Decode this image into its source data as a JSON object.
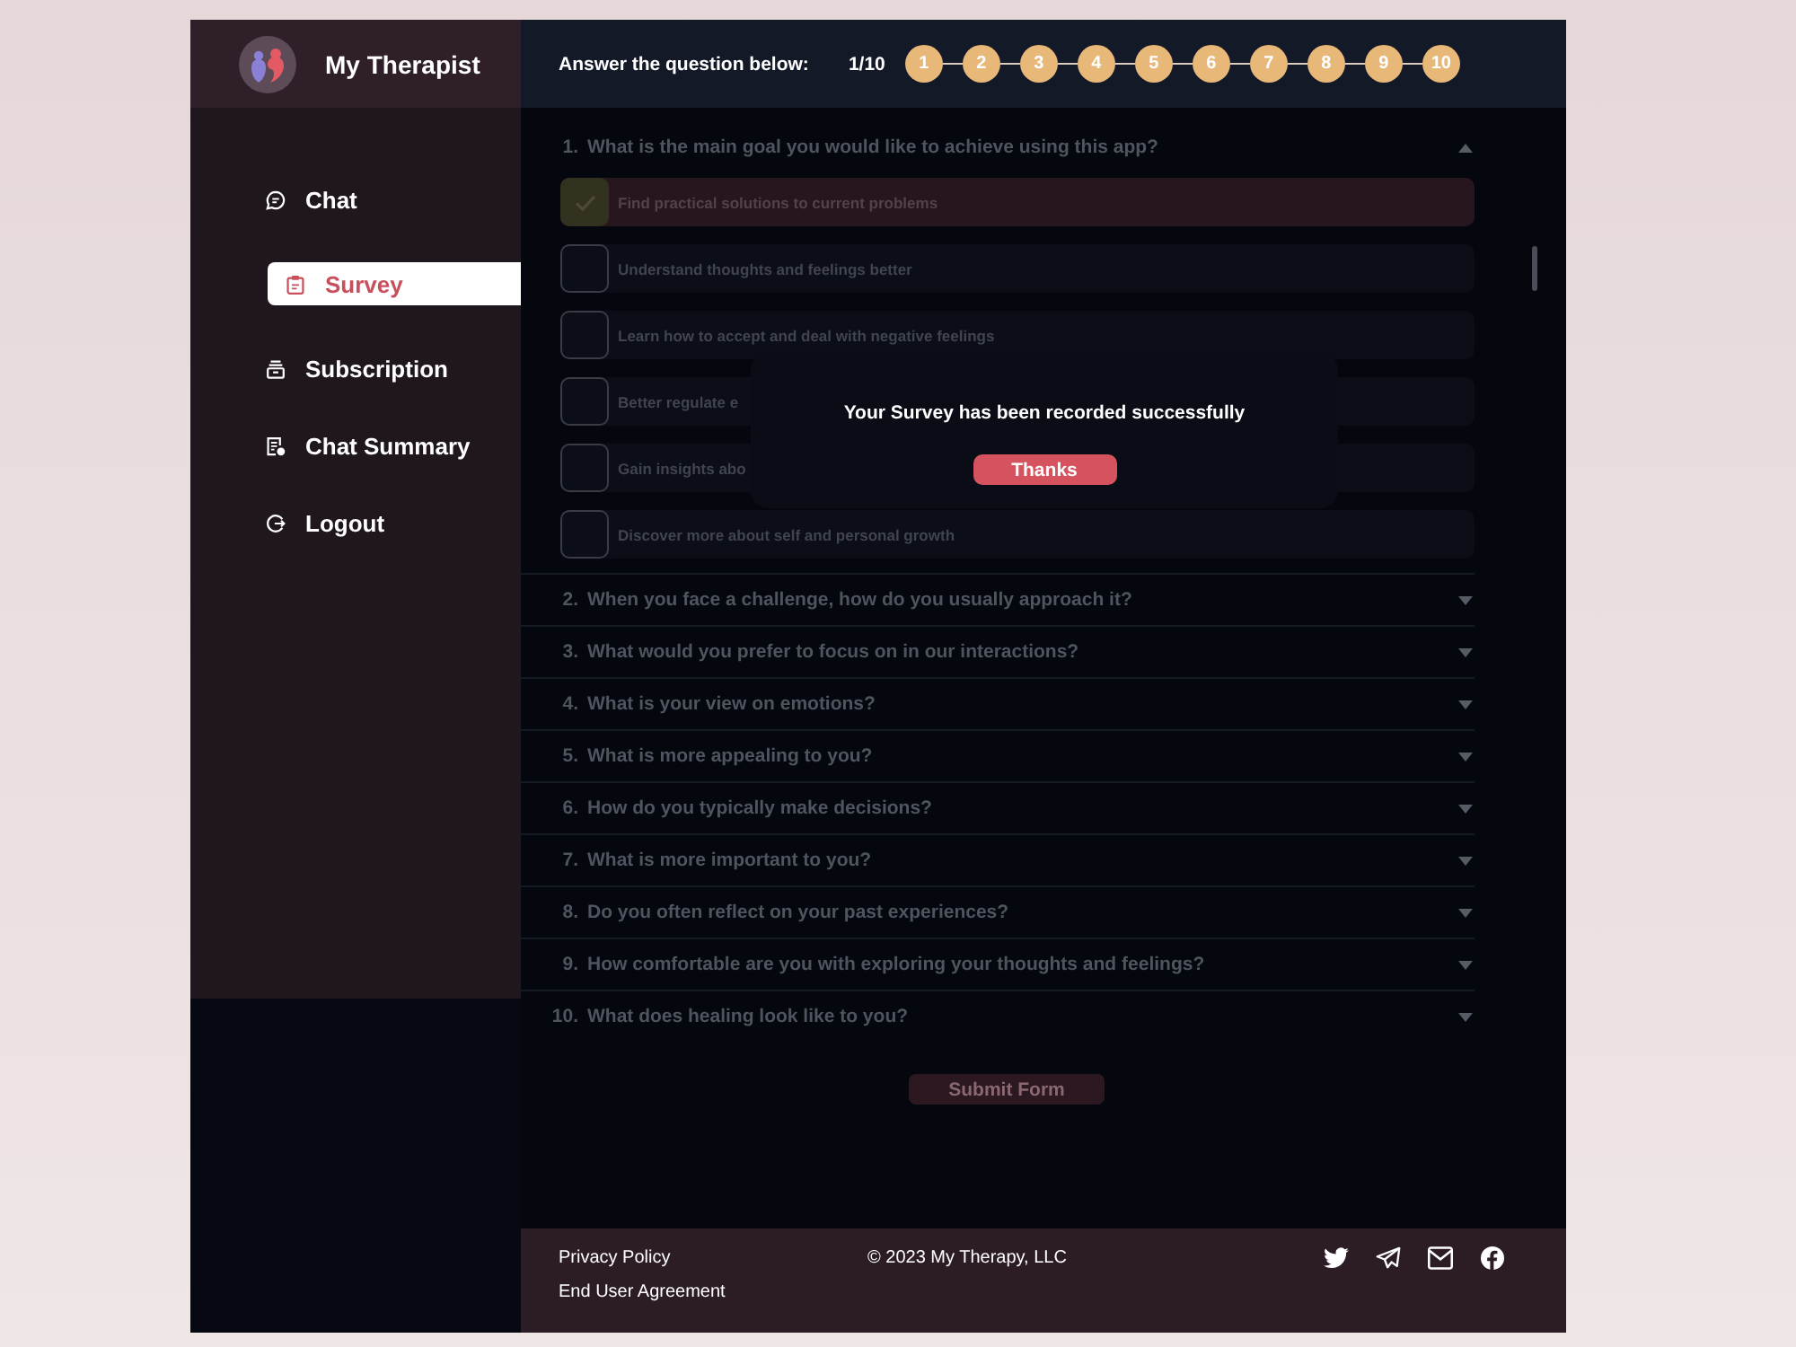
{
  "sidebar": {
    "brand": "My Therapist",
    "items": [
      {
        "kind": "chat",
        "label": "Chat",
        "selected": false
      },
      {
        "kind": "survey",
        "label": "Survey",
        "selected": true
      },
      {
        "kind": "subscription",
        "label": "Subscription",
        "selected": false
      },
      {
        "kind": "summary",
        "label": "Chat Summary",
        "selected": false
      },
      {
        "kind": "logout",
        "label": "Logout",
        "selected": false
      }
    ]
  },
  "progress": {
    "prompt": "Answer the question below:",
    "counter": "1/10",
    "steps": [
      "1",
      "2",
      "3",
      "4",
      "5",
      "6",
      "7",
      "8",
      "9",
      "10"
    ]
  },
  "questions": [
    {
      "number": "1.",
      "text": "What is the main goal you would like to achieve using this app?",
      "expanded": true,
      "options": [
        {
          "text": "Find practical solutions to current problems",
          "checked": true
        },
        {
          "text": "Understand thoughts and feelings better",
          "checked": false
        },
        {
          "text": "Learn how to accept and deal with negative feelings",
          "checked": false
        },
        {
          "text": "Better regulate e",
          "checked": false
        },
        {
          "text": "Gain insights abo",
          "checked": false
        },
        {
          "text": "Discover more about self and personal growth",
          "checked": false
        }
      ]
    },
    {
      "number": "2.",
      "text": "When you face a challenge, how do you usually approach it?",
      "expanded": false
    },
    {
      "number": "3.",
      "text": "What would you prefer to focus on in our interactions?",
      "expanded": false
    },
    {
      "number": "4.",
      "text": "What is your view on emotions?",
      "expanded": false
    },
    {
      "number": "5.",
      "text": "What is more appealing to you?",
      "expanded": false
    },
    {
      "number": "6.",
      "text": "How do you typically make decisions?",
      "expanded": false
    },
    {
      "number": "7.",
      "text": "What is more important to you?",
      "expanded": false
    },
    {
      "number": "8.",
      "text": "Do you often reflect on your past experiences?",
      "expanded": false
    },
    {
      "number": "9.",
      "text": "How comfortable are you with exploring your thoughts and feelings?",
      "expanded": false
    },
    {
      "number": "10.",
      "text": "What does healing look like to you?",
      "expanded": false
    }
  ],
  "submit_button": "Submit Form",
  "dialog": {
    "message": "Your Survey has been recorded successfully",
    "button": "Thanks"
  },
  "footer": {
    "links": [
      "Privacy Policy",
      "End User Agreement"
    ],
    "copyright": "© 2023 My Therapy, LLC",
    "social": [
      {
        "kind": "bird"
      },
      {
        "kind": "plane"
      },
      {
        "kind": "envelope"
      },
      {
        "kind": "fcircle"
      }
    ]
  }
}
